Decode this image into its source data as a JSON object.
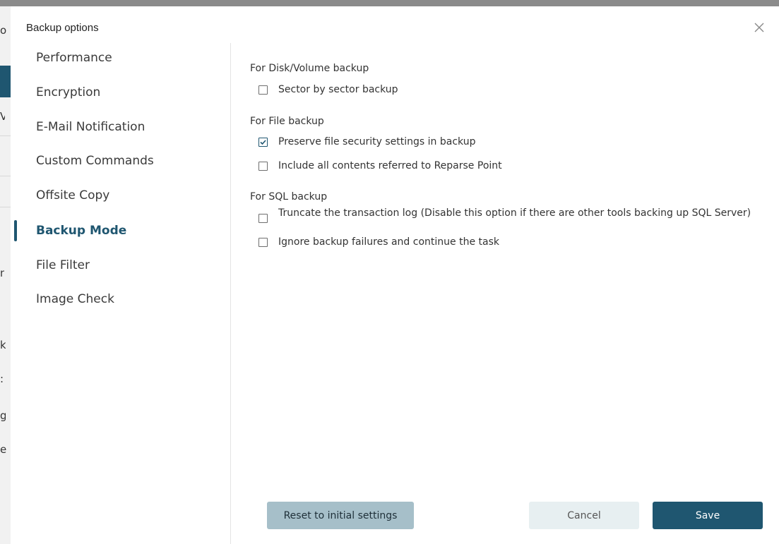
{
  "background_fragments": [
    "o",
    "V",
    "n",
    "k",
    ":",
    "g",
    "el"
  ],
  "dialog": {
    "title": "Backup options",
    "close_icon": "close-icon"
  },
  "nav": {
    "items": [
      {
        "label": "Performance",
        "active": false
      },
      {
        "label": "Encryption",
        "active": false
      },
      {
        "label": "E-Mail Notification",
        "active": false
      },
      {
        "label": "Custom Commands",
        "active": false
      },
      {
        "label": "Offsite Copy",
        "active": false
      },
      {
        "label": "Backup Mode",
        "active": true
      },
      {
        "label": "File Filter",
        "active": false
      },
      {
        "label": "Image Check",
        "active": false
      }
    ]
  },
  "content": {
    "disk_heading": "For Disk/Volume backup",
    "disk_options": [
      {
        "label": "Sector by sector backup",
        "checked": false
      }
    ],
    "file_heading": "For File backup",
    "file_options": [
      {
        "label": "Preserve file security settings in backup",
        "checked": true
      },
      {
        "label": "Include all contents referred to Reparse Point",
        "checked": false
      }
    ],
    "sql_heading": "For SQL backup",
    "sql_options": [
      {
        "label": "Truncate the transaction log (Disable this option if there are other tools backing up SQL Server)",
        "checked": false
      },
      {
        "label": "Ignore backup failures and continue the task",
        "checked": false
      }
    ]
  },
  "buttons": {
    "reset": "Reset to initial settings",
    "cancel": "Cancel",
    "save": "Save"
  },
  "colors": {
    "accent": "#1f5670",
    "reset_bg": "#a6bfc9",
    "cancel_bg": "#e7eff1"
  }
}
